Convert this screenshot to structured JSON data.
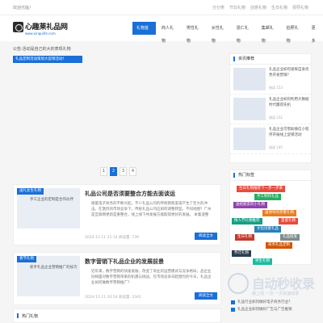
{
  "topbar": {
    "welcome": "欢迎光临！",
    "links": [
      "分分类",
      "节日礼物",
      "创意礼物",
      "生日礼物",
      "领导礼物"
    ]
  },
  "logo": {
    "name": "心趣莱礼品网",
    "url": "www.xinqulife.com"
  },
  "nav": [
    "礼物首页",
    "商人礼物",
    "男性礼物",
    "女性礼物",
    "恩仁礼物",
    "集邮礼物",
    "拍照礼物",
    "更多"
  ],
  "crumb": "公告:活动是自己的大的表现礼物",
  "notice_button": "礼品定制活动策划大促销活动！",
  "pager": [
    "1",
    "2",
    "3",
    "4"
  ],
  "articles": [
    {
      "tag": "送礼女生礼物",
      "caption": "手工企业的定制是合作伙伴",
      "title": "礼品公司是否须要整合方能去面谈运",
      "body": "随着电子商务的不断兴起，不少礼品公司的传统销售渠道产生了巨大的冲击。在激烈的市场竞争下，传统礼品公司应如何调整转型。不同地图？广州是互联网更新是重整合，线上线下共发展方能取得更好的发展。 本着道整",
      "meta": "2024-11-11 21:14 阅读量: 739",
      "read": "阅读全文"
    },
    {
      "tag": "春节礼物",
      "caption": "新手礼品企业营销推广的技巧",
      "title": "数字营销下礼品企业的发展前景",
      "body": "近年来，数字营销的快速发展，改变了商业的运营模式与竞争格局，品企业同样面对数字营销带来的机遇与挑战。在市场竞争日趋激烈的今天，礼品企业如何做数字营销推广？",
      "meta": "2024-11-11 20:54 阅读量: 2341",
      "read": "阅读全文"
    }
  ],
  "sidebar": {
    "recommend_title": "资讯推荐",
    "recommend": [
      {
        "title": "礼品企业如何发挥自身优势开发营销？",
        "views": "阅读 153"
      },
      {
        "title": "礼品企业如何利用大数据时代赢得先机",
        "views": "阅读 232"
      },
      {
        "title": "礼品企业可借助微信小程序开展线上促销活动",
        "views": "阅读 145"
      }
    ],
    "tags_title": "热门标签",
    "tags": [
      {
        "text": "生日礼物推荐下一步一步来",
        "color": "#e74c3c"
      },
      {
        "text": "手工制作礼品",
        "color": "#27ae60"
      },
      {
        "text": "送给朋友的小礼物",
        "color": "#8e44ad"
      },
      {
        "text": "送领导的贵重礼物",
        "color": "#e67e22"
      },
      {
        "text": "情人节礼物推荐",
        "color": "#16a085"
      },
      {
        "text": "文化创意礼品",
        "color": "#2980b9"
      },
      {
        "text": "生日礼物",
        "color": "#c0392b"
      },
      {
        "text": "商务礼品定制",
        "color": "#d35400"
      },
      {
        "text": "乔迁礼物",
        "color": "#2c3e50"
      },
      {
        "text": "男生礼物",
        "color": "#1abc9c"
      },
      {
        "text": "圣诞礼物",
        "color": "#e74c3c"
      },
      {
        "text": "礼品批发",
        "color": "#7f8c8d"
      }
    ],
    "bottom_list": [
      "礼品行业如何做好电子商务行业？",
      "礼品企业如何做好广告与广告推销"
    ]
  },
  "watermark": {
    "title": "自动秒收录",
    "sub": "做上线 一页 一页快速收录"
  },
  "more_section": "热门礼物"
}
